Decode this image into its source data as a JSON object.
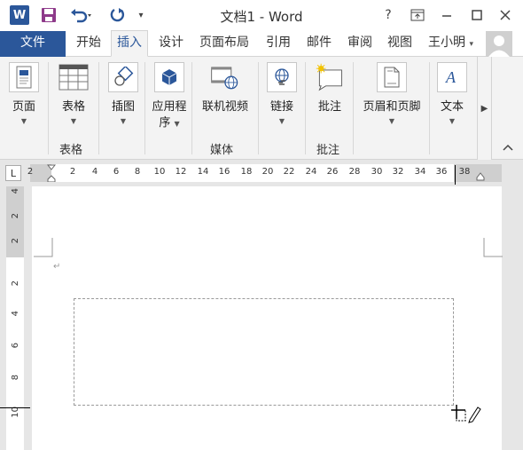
{
  "titlebar": {
    "app_logo": "W",
    "title": "文档1 - Word",
    "icons": [
      "save-icon",
      "undo-icon",
      "redo-icon",
      "customize-icon"
    ],
    "window_buttons": [
      "help-icon",
      "ribbon-display-icon",
      "minimize-icon",
      "maximize-icon",
      "close-icon"
    ],
    "help_label": "?"
  },
  "tabs": {
    "file": "文件",
    "items": [
      "开始",
      "插入",
      "设计",
      "页面布局",
      "引用",
      "邮件",
      "审阅",
      "视图"
    ],
    "active": "插入",
    "user_name": "王小明"
  },
  "ribbon": {
    "buttons": [
      {
        "label": "页面",
        "icon": "page-icon"
      },
      {
        "label": "表格",
        "icon": "table-icon"
      },
      {
        "label": "插图",
        "icon": "illustrations-icon"
      },
      {
        "label": "应用程",
        "label2": "序",
        "icon": "apps-icon"
      },
      {
        "label": "联机视频",
        "icon": "online-video-icon"
      },
      {
        "label": "链接",
        "icon": "link-icon"
      },
      {
        "label": "批注",
        "icon": "comment-icon"
      },
      {
        "label": "页眉和页脚",
        "icon": "header-footer-icon"
      },
      {
        "label": "文本",
        "icon": "text-icon"
      }
    ],
    "groups": [
      "表格",
      "媒体",
      "批注"
    ]
  },
  "ruler": {
    "tab_selector": "L",
    "h_numbers": [
      "2",
      "2",
      "4",
      "6",
      "8",
      "10",
      "12",
      "14",
      "16",
      "18",
      "20",
      "22",
      "24",
      "26",
      "28",
      "30",
      "32",
      "34",
      "36",
      "38"
    ],
    "v_numbers": [
      "4",
      "2",
      "2",
      "2",
      "4",
      "6",
      "8",
      "10"
    ]
  },
  "document": {
    "paragraph_mark": "↵"
  },
  "colors": {
    "accent": "#2b579a",
    "ribbon_bg": "#f3f3f3",
    "workspace_bg": "#e6e6e6"
  }
}
